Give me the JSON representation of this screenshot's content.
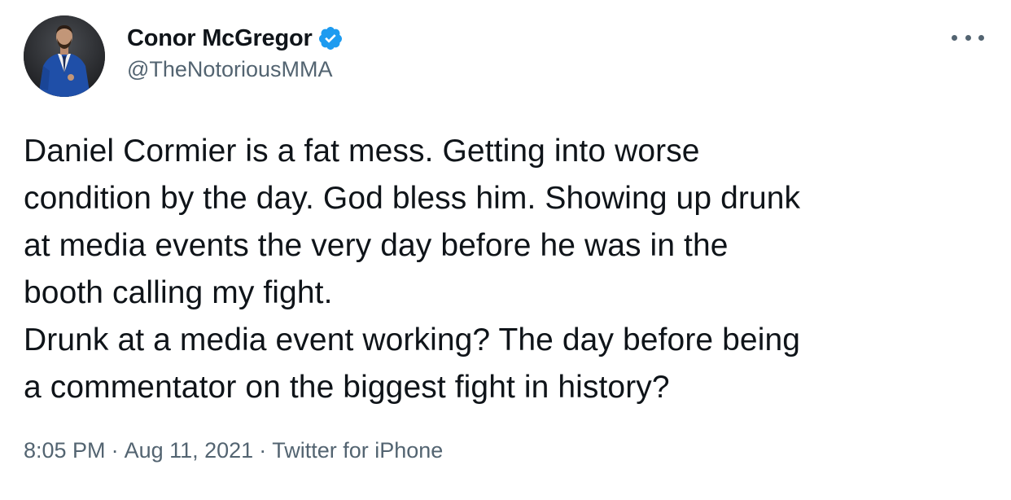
{
  "author": {
    "display_name": "Conor McGregor",
    "handle": "@TheNotoriousMMA",
    "verified": true
  },
  "icons": {
    "verified": "verified-badge-icon",
    "more": "more-options-icon"
  },
  "colors": {
    "verified_blue": "#1d9bf0",
    "text_primary": "#0f1419",
    "text_secondary": "#536471"
  },
  "tweet": {
    "lines": [
      "Daniel Cormier is a fat mess. Getting into worse",
      "condition by the day. God bless him. Showing up drunk",
      "at media events the very day before he was in the",
      "booth calling my fight.",
      "Drunk at a media event working? The day before being",
      "a commentator on the biggest fight in history?"
    ]
  },
  "meta": {
    "time": "8:05 PM",
    "date": "Aug 11, 2021",
    "source": "Twitter for iPhone",
    "separator": "·"
  }
}
